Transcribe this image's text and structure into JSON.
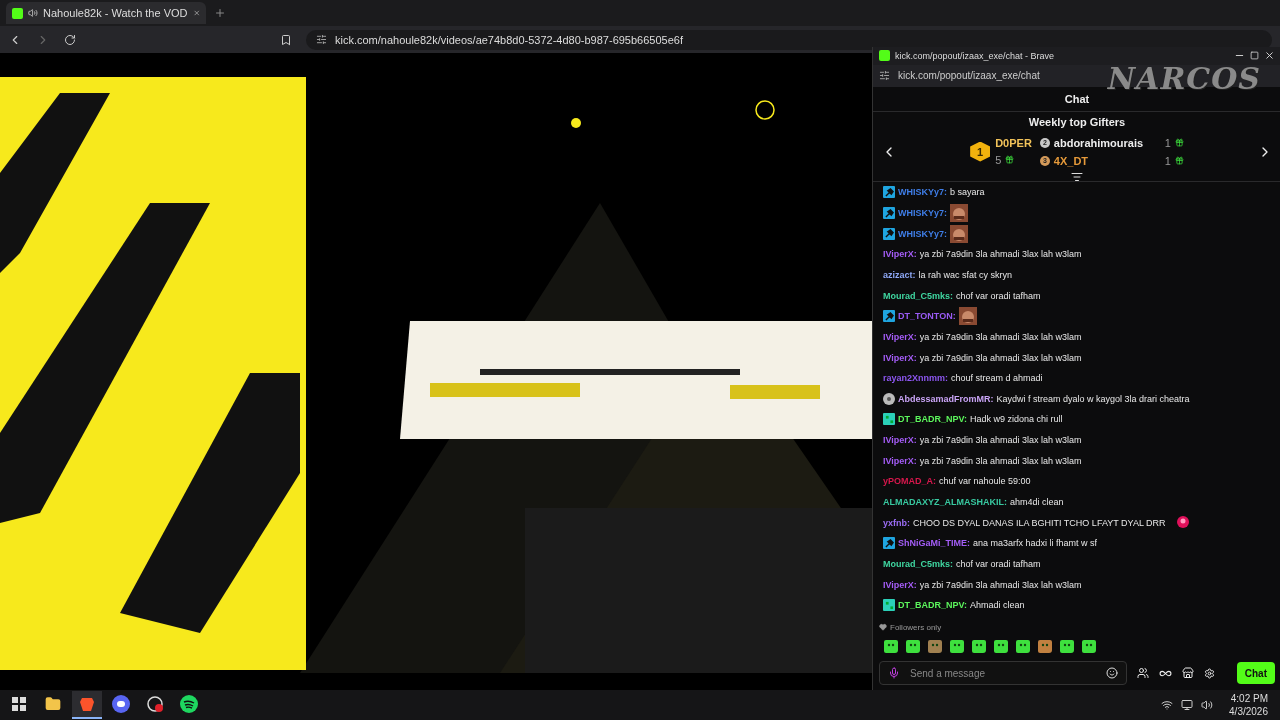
{
  "browser": {
    "tab": {
      "title": "Nahoule82k - Watch the VOD",
      "audio": true
    },
    "address": "kick.com/nahoule82k/videos/ae74b8d0-5372-4d80-b987-695b66505e6f"
  },
  "popup": {
    "title": "kick.com/popout/izaax_exe/chat - Brave",
    "address": "kick.com/popout/izaax_exe/chat",
    "overlay_logo": "NARCOS",
    "chat": {
      "header": "Chat",
      "gifters": {
        "title": "Weekly top Gifters",
        "items": [
          {
            "rank": "1",
            "name": "D0PER",
            "count": "5"
          },
          {
            "rank": "2",
            "name": "abdorahimourais",
            "count": "1"
          },
          {
            "rank": "3",
            "name": "4X_DT",
            "count": "1"
          }
        ]
      },
      "messages": [
        {
          "user": "WHISKYy7:",
          "color": "#3f7ee8",
          "badge": {
            "kind": "mod"
          },
          "kind": "text",
          "text": "b sayara"
        },
        {
          "user": "WHISKYy7:",
          "color": "#3f7ee8",
          "badge": {
            "kind": "mod"
          },
          "kind": "emote"
        },
        {
          "user": "WHISKYy7:",
          "color": "#3f7ee8",
          "badge": {
            "kind": "mod"
          },
          "kind": "emote"
        },
        {
          "user": "IViperX:",
          "color": "#a45cf6",
          "kind": "text",
          "text": "ya zbi 7a9din 3la ahmadi 3lax lah w3lam"
        },
        {
          "user": "azizact:",
          "color": "#8ea8f6",
          "kind": "text",
          "text": "la rah wac sfat cy skryn"
        },
        {
          "user": "Mourad_C5mks:",
          "color": "#3fd6a0",
          "kind": "text",
          "text": "chof var oradi tafham"
        },
        {
          "user": "DT_TONTON:",
          "color": "#9a5bf5",
          "badge": {
            "kind": "mod"
          },
          "kind": "emote"
        },
        {
          "user": "IViperX:",
          "color": "#a45cf6",
          "kind": "text",
          "text": "ya zbi 7a9din 3la ahmadi 3lax lah w3lam"
        },
        {
          "user": "IViperX:",
          "color": "#a45cf6",
          "kind": "text",
          "text": "ya zbi 7a9din 3la ahmadi 3lax lah w3lam"
        },
        {
          "user": "rayan2Xnnmm:",
          "color": "#8c56f0",
          "kind": "text",
          "text": "chouf stream d ahmadi"
        },
        {
          "user": "AbdessamadFromMR:",
          "color": "#c9a4f6",
          "badge": {
            "kind": "gear"
          },
          "kind": "text",
          "text": "Kaydwi f stream dyalo w kaygol 3la drari cheatra"
        },
        {
          "user": "DT_BADR_NPV:",
          "color": "#5cf55c",
          "badge": {
            "kind": "og"
          },
          "kind": "text",
          "text": "Hadk w9 zidona chi rull"
        },
        {
          "user": "IViperX:",
          "color": "#a45cf6",
          "kind": "text",
          "text": "ya zbi 7a9din 3la ahmadi 3lax lah w3lam"
        },
        {
          "user": "IViperX:",
          "color": "#a45cf6",
          "kind": "text",
          "text": "ya zbi 7a9din 3la ahmadi 3lax lah w3lam"
        },
        {
          "user": "yPOMAD_A:",
          "color": "#d6174c",
          "kind": "text",
          "text": "chuf var nahoule 59:00"
        },
        {
          "user": "ALMADAXYZ_ALMASHAKIL:",
          "color": "#38c9a0",
          "kind": "text",
          "text": "ahm4di clean"
        },
        {
          "user": "yxfnb:",
          "color": "#9b6df5",
          "kind": "text",
          "text": "CHOO DS DYAL DANAS ILA BGHITI TCHO LFAYT DYAL DRR",
          "trailing_emote": true
        },
        {
          "user": "ShNiGaMi_TIME:",
          "color": "#a35df5",
          "badge": {
            "kind": "mod"
          },
          "kind": "text",
          "text": "ana ma3arfx hadxi li fhamt w sf"
        },
        {
          "user": "Mourad_C5mks:",
          "color": "#3fd6a0",
          "kind": "text",
          "text": "chof var oradi tafham"
        },
        {
          "user": "IViperX:",
          "color": "#a45cf6",
          "kind": "text",
          "text": "ya zbi 7a9din 3la ahmadi 3lax lah w3lam"
        },
        {
          "user": "DT_BADR_NPV:",
          "color": "#5cf55c",
          "badge": {
            "kind": "og"
          },
          "kind": "text",
          "text": "Ahmadi clean"
        }
      ],
      "mode": "Followers only",
      "input": {
        "placeholder": "Send a message"
      },
      "send_button": "Chat"
    }
  },
  "taskbar": {
    "apps": [
      {
        "kind": "explorer",
        "selected": false
      },
      {
        "kind": "brave",
        "selected": true
      },
      {
        "kind": "discord",
        "selected": false
      },
      {
        "kind": "recorder",
        "selected": false
      },
      {
        "kind": "spotify",
        "selected": false
      }
    ],
    "clock": {
      "time": "4:02 PM",
      "date": "4/3/2026"
    }
  }
}
